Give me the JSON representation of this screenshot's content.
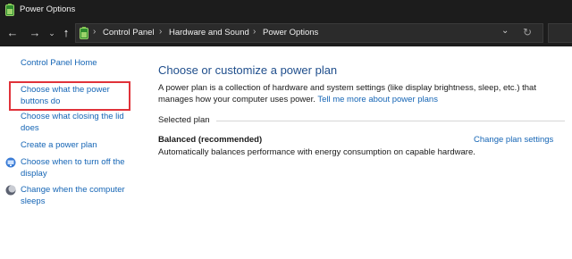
{
  "window": {
    "title": "Power Options"
  },
  "nav": {
    "back_icon": "←",
    "forward_icon": "→",
    "recent_icon": "⌄",
    "up_icon": "↑"
  },
  "breadcrumb": {
    "separator": "›",
    "items": [
      "Control Panel",
      "Hardware and Sound",
      "Power Options"
    ],
    "dropdown_icon": "⌄",
    "refresh_icon": "↻"
  },
  "sidebar": {
    "home": "Control Panel Home",
    "links": [
      "Choose what the power buttons do",
      "Choose what closing the lid does",
      "Create a power plan",
      "Choose when to turn off the display",
      "Change when the computer sleeps"
    ]
  },
  "main": {
    "heading": "Choose or customize a power plan",
    "description": "A power plan is a collection of hardware and system settings (like display brightness, sleep, etc.) that manages how your computer uses power.",
    "more_link": "Tell me more about power plans",
    "selected_label": "Selected plan",
    "plan_name": "Balanced (recommended)",
    "plan_description": "Automatically balances performance with energy consumption on capable hardware.",
    "change_link": "Change plan settings"
  },
  "colors": {
    "accent": "#1565b5",
    "heading": "#1f4e8c",
    "highlight": "#e0323a",
    "titlebar": "#1c1c1c"
  },
  "icons": {
    "app": "power-battery-icon",
    "display": "monitor-icon",
    "sleep": "moon-icon"
  }
}
